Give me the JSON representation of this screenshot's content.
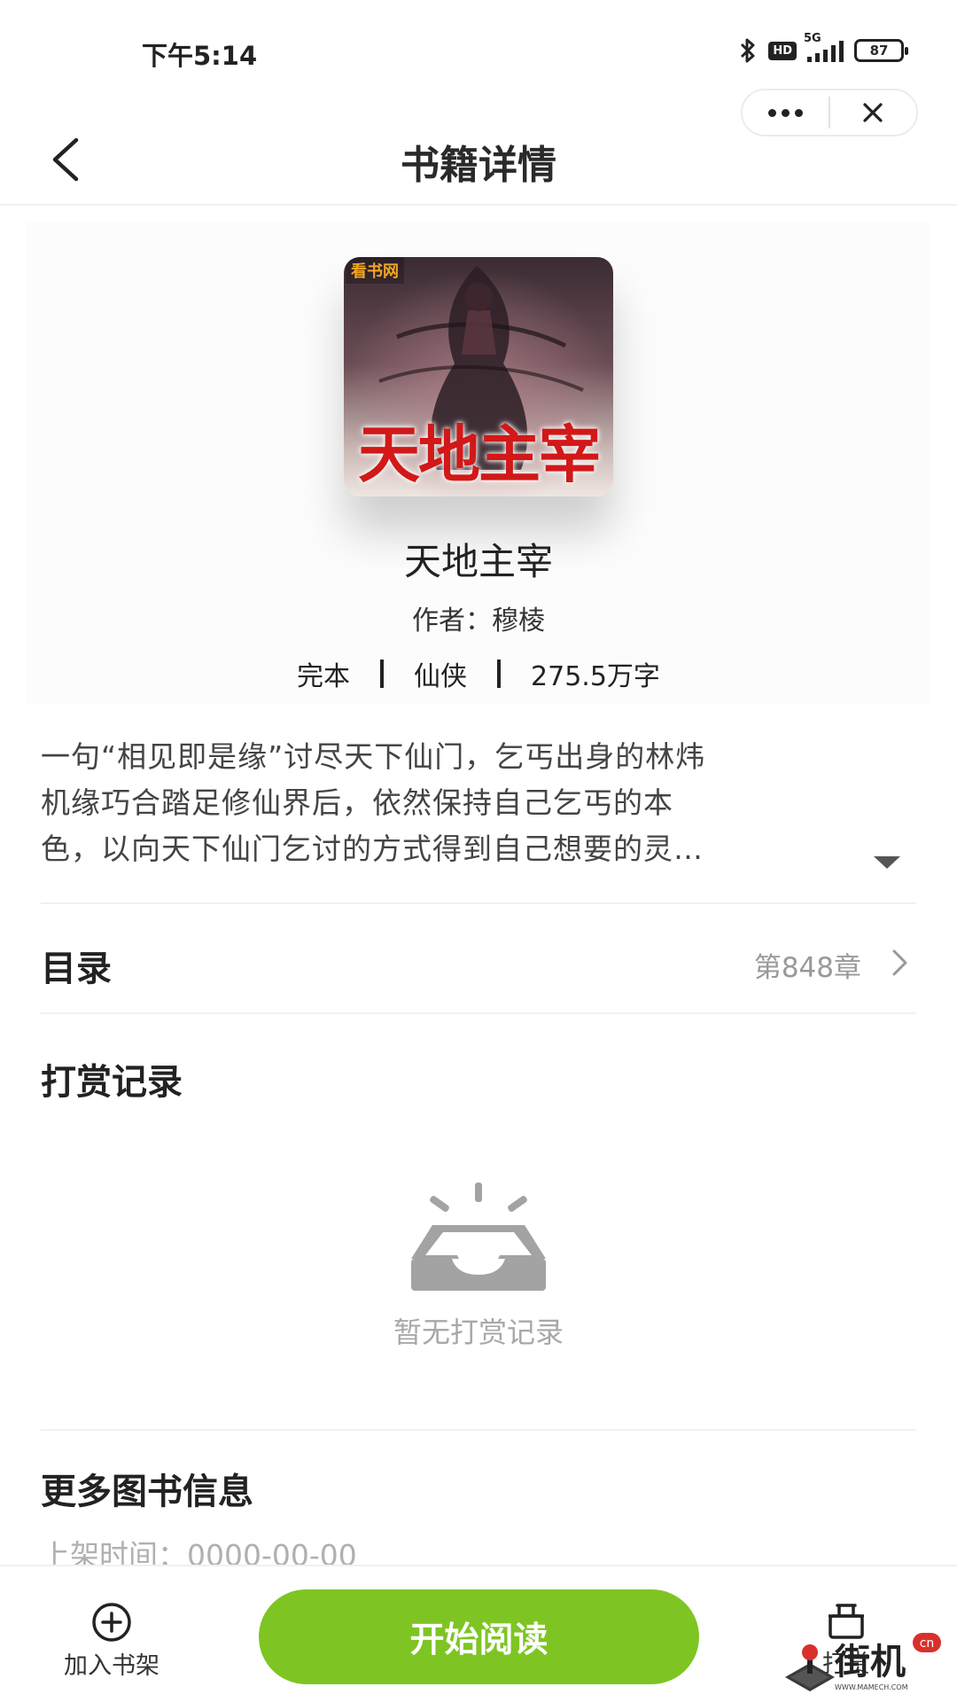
{
  "status_bar": {
    "time": "下午5:14",
    "network": "5G",
    "hd_badge": "HD",
    "battery": "87",
    "icons": [
      "bluetooth-icon",
      "hd-icon",
      "signal-icon",
      "battery-icon"
    ]
  },
  "capsule": {
    "more_icon": "more-dots-icon",
    "close_icon": "close-icon"
  },
  "nav": {
    "title": "书籍详情",
    "back_icon": "back-chevron-icon"
  },
  "book": {
    "cover_tag": "看书网",
    "cover_title": "天地主宰",
    "title": "天地主宰",
    "author": "作者：穆棱",
    "status": "完本",
    "genre": "仙侠",
    "word_count": "275.5万字"
  },
  "description": {
    "lines": [
      "一句“相见即是缘”讨尽天下仙门，乞丐出身的林炜",
      "机缘巧合踏足修仙界后，依然保持自己乞丐的本",
      "色，以向天下仙门乞讨的方式得到自己想要的灵…"
    ]
  },
  "catalog": {
    "label": "目录",
    "latest_chapter": "第848章"
  },
  "reward_section": {
    "title": "打赏记录",
    "empty_text": "暂无打赏记录"
  },
  "more_info": {
    "title": "更多图书信息",
    "shelf_date": "上架时间：0000-00-00"
  },
  "bottom_bar": {
    "add_shelf_label": "加入书架",
    "start_reading_label": "开始阅读",
    "reward_label": "打赏"
  },
  "colors": {
    "accent_green": "#7ec523",
    "text_primary": "#222222",
    "text_muted": "#999999"
  },
  "watermark": {
    "text": "街机",
    "domain": "cn",
    "url": "WWW.MAMECH.COM"
  }
}
